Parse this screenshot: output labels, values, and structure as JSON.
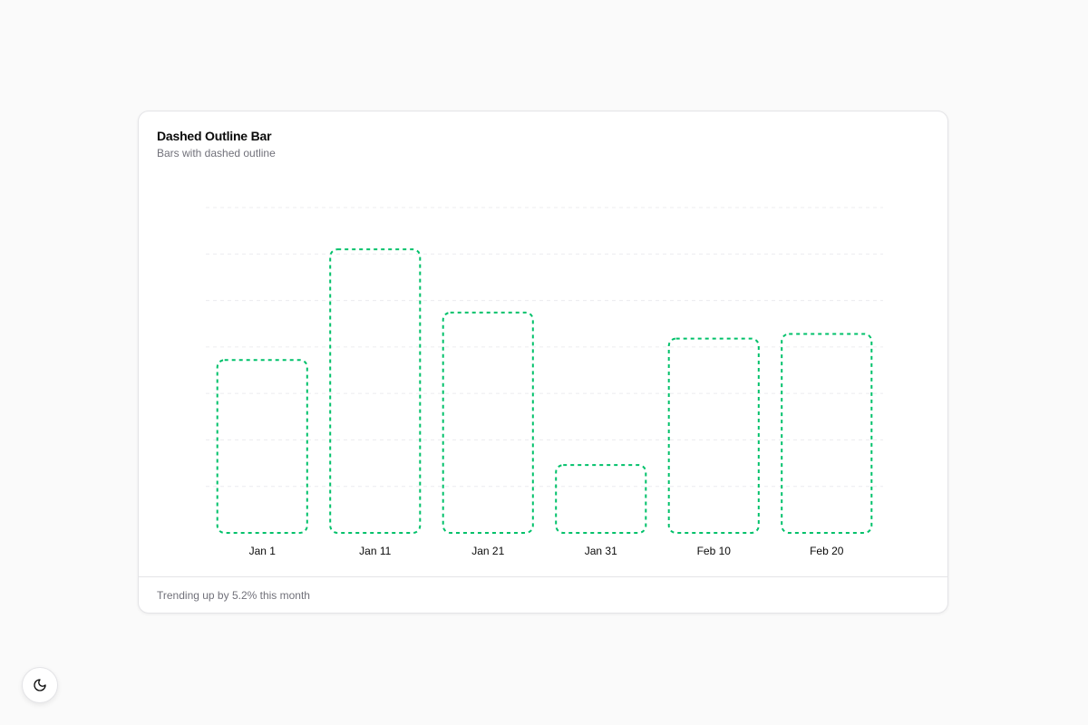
{
  "card": {
    "title": "Dashed Outline Bar",
    "subtitle": "Bars with dashed outline",
    "footer": "Trending up by 5.2% this month"
  },
  "colors": {
    "bar_stroke": "#00c16a",
    "grid": "#ececef",
    "background": "#fafafa"
  },
  "theme_toggle": {
    "icon": "moon-icon"
  },
  "chart_data": {
    "type": "bar",
    "categories": [
      "Jan 1",
      "Jan 11",
      "Jan 21",
      "Jan 31",
      "Feb 10",
      "Feb 20"
    ],
    "values": [
      186,
      305,
      237,
      73,
      209,
      214
    ],
    "title": "Dashed Outline Bar",
    "subtitle": "Bars with dashed outline",
    "xlabel": "",
    "ylabel": "",
    "ylim": [
      0,
      350
    ],
    "grid": "horizontal dashed",
    "legend": "none",
    "bar_style": "dashed outline, no fill, rounded corners"
  }
}
